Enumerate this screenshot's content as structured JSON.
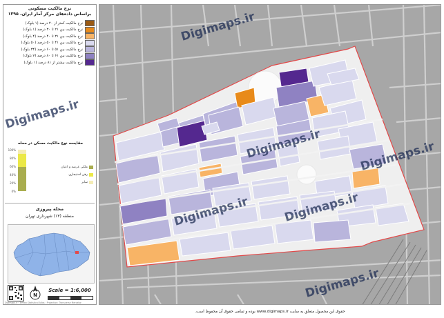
{
  "legend": {
    "title_line1": "نرخ مالکیت مسکونی",
    "title_line2": "براساس داده‌های مرکز آمار ایران، ۱۳۹۵",
    "classes": [
      {
        "label": "نرخ مالکیت کمتر از ۲۰ درصد (۱ بلوک)",
        "color": "#9a5a14"
      },
      {
        "label": "نرخ مالکیت بین ۲۱ تا ۳۰ درصد (۱ بلوک)",
        "color": "#e88a1a"
      },
      {
        "label": "نرخ مالکیت بین ۳۱ تا ۴۰ درصد (۴ بلوک)",
        "color": "#f8b466"
      },
      {
        "label": "نرخ مالکیت بین ۴۱ تا ۵۰ درصد (۵۰ بلوک)",
        "color": "#d9d9ee"
      },
      {
        "label": "نرخ مالکیت بین ۵۱ تا ۶۰ درصد (۳۴ بلوک)",
        "color": "#b9b5dc"
      },
      {
        "label": "نرخ مالکیت بین ۶۱ تا ۸۰ درصد (۷ بلوک)",
        "color": "#8f82c2"
      },
      {
        "label": "نرخ مالکیت بیشتر از ۸۱ درصد (۱ بلوک)",
        "color": "#54288f"
      }
    ]
  },
  "tenure_chart": {
    "title": "مقایسه نوع مالکیت مسکن در محله",
    "ticks": [
      "100%",
      "80%",
      "60%",
      "40%",
      "20%",
      "0%"
    ],
    "segments": [
      {
        "label": "ملکی عرصه و اعیان",
        "color": "#a9ad4f",
        "percent": 58
      },
      {
        "label": "رهن استیجاری",
        "color": "#ebe847",
        "percent": 32
      },
      {
        "label": "سایر",
        "color": "#f4ecb6",
        "percent": 10
      }
    ]
  },
  "area": {
    "name": "محله پیروزی",
    "subtitle": "منطقه (۱۳) شهرداری تهران"
  },
  "scale": {
    "label": "Scale = 1:6,000"
  },
  "compass": {
    "letter": "N"
  },
  "small_credit": "Digimaps.ir · Tehran Statistical Atlas · Projection: Transverse Mercator",
  "watermark": "Digimaps.ir",
  "footer": "حقوق این محصول متعلق به سایت www.digimaps.ir بوده و تمامی حقوق آن محفوظ است.",
  "colors": {
    "boundary": "#e34a4a",
    "road_background": "#a7a7a7",
    "street_line": "#d6d6d6",
    "inner_street": "#f2f2f2"
  },
  "icons": [
    "qr-code-icon",
    "north-arrow-icon"
  ]
}
